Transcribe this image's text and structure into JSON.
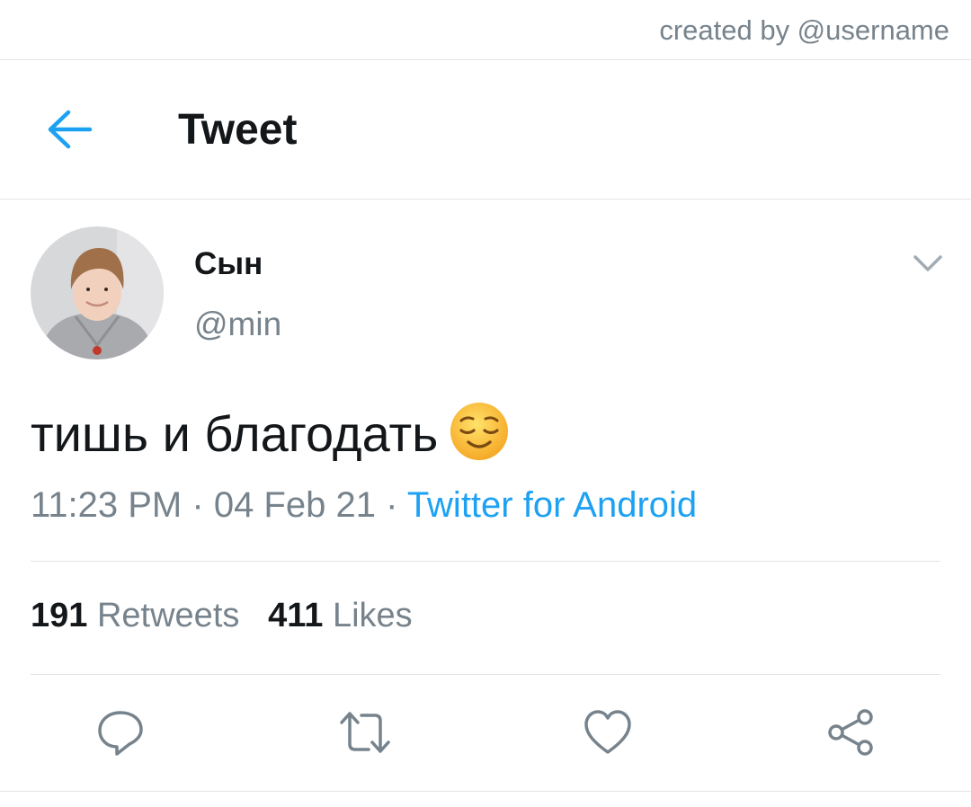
{
  "credit": {
    "text": "created by @username"
  },
  "appbar": {
    "title": "Tweet",
    "back_icon": "back-arrow-icon"
  },
  "author": {
    "display_name": "Сын",
    "handle": "@min",
    "avatar_icon": "profile-photo"
  },
  "tweet": {
    "text": "тишь и благодать",
    "emoji": "relieved-face-emoji",
    "time": "11:23 PM",
    "separator": "·",
    "date": "04 Feb 21",
    "source": "Twitter for Android"
  },
  "stats": {
    "retweets_count": "191",
    "retweets_label": "Retweets",
    "likes_count": "411",
    "likes_label": "Likes"
  },
  "actions": [
    "reply-icon",
    "retweet-icon",
    "like-icon",
    "share-icon"
  ],
  "colors": {
    "accent": "#1da1f2",
    "text_primary": "#14171a",
    "text_secondary": "#77838c",
    "divider": "#e1e4e7"
  }
}
